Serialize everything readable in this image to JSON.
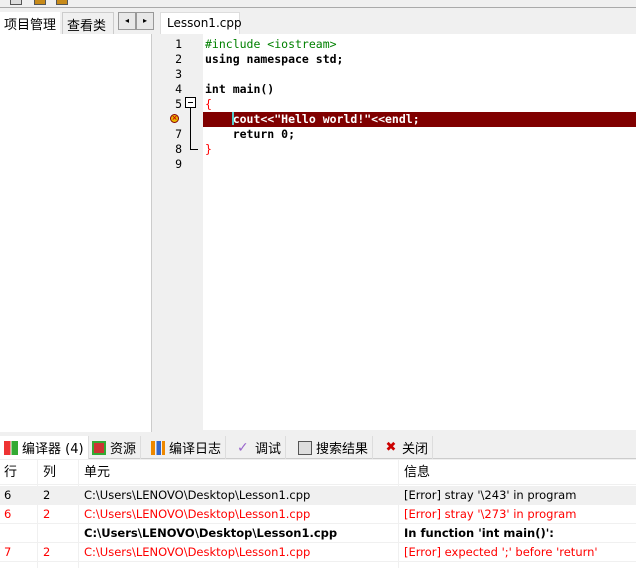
{
  "left_panel": {
    "tabs": [
      "项目管理",
      "查看类"
    ],
    "scroll_left": "◂",
    "scroll_right": "▸"
  },
  "editor": {
    "tab": "Lesson1.cpp",
    "lines": [
      {
        "n": "1",
        "code": "#include <iostream>"
      },
      {
        "n": "2",
        "code": "using namespace std;"
      },
      {
        "n": "3",
        "code": ""
      },
      {
        "n": "4",
        "code": "int main()"
      },
      {
        "n": "5",
        "code": "{"
      },
      {
        "n": "6",
        "code": "    cout<<\"Hello world!\"<<endl;"
      },
      {
        "n": "7",
        "code": "    return 0;"
      },
      {
        "n": "8",
        "code": "}"
      },
      {
        "n": "9",
        "code": ""
      }
    ]
  },
  "bottom_tabs": [
    "编译器 (4)",
    "资源",
    "编译日志",
    "调试",
    "搜索结果",
    "关闭"
  ],
  "table": {
    "headers": [
      "行",
      "列",
      "单元",
      "信息"
    ],
    "rows": [
      [
        "6",
        "2",
        "C:\\Users\\LENOVO\\Desktop\\Lesson1.cpp",
        "[Error] stray '\\243' in program"
      ],
      [
        "6",
        "2",
        "C:\\Users\\LENOVO\\Desktop\\Lesson1.cpp",
        "[Error] stray '\\273' in program"
      ],
      [
        "",
        "",
        "C:\\Users\\LENOVO\\Desktop\\Lesson1.cpp",
        "In function 'int main()':"
      ],
      [
        "7",
        "2",
        "C:\\Users\\LENOVO\\Desktop\\Lesson1.cpp",
        "[Error] expected ';' before 'return'"
      ]
    ]
  },
  "colors": {
    "error_line": "#800000",
    "error_text": "#ff0000"
  }
}
